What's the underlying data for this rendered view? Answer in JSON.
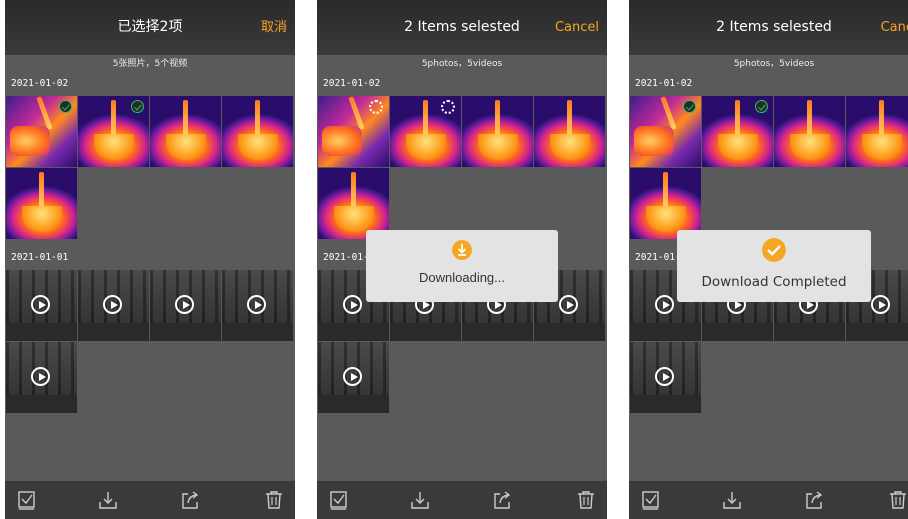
{
  "screens": [
    {
      "title": "已选择2项",
      "cancel": "取消",
      "subtitle": "5张照片，5个视频",
      "date_1": "2021-01-02",
      "date_2": "2021-01-01"
    },
    {
      "title": "2 Items selested",
      "cancel": "Cancel",
      "subtitle": "5photos，5videos",
      "date_1": "2021-01-02",
      "date_2": "2021-01-01",
      "toast": {
        "text": "Downloading...",
        "icon": "download-icon"
      }
    },
    {
      "title": "2 Items selested",
      "cancel": "Cance",
      "subtitle": "5photos，5videos",
      "date_1": "2021-01-02",
      "date_2": "2021-01-01",
      "toast": {
        "text": "Download Completed",
        "icon": "checkmark-icon"
      }
    }
  ],
  "colors": {
    "accent": "#f5a623",
    "selected": "#22c55e",
    "background": "#5a5a5a",
    "bar": "#3a3a3a"
  },
  "toolbar_icons": [
    "select-all-icon",
    "download-icon",
    "share-icon",
    "trash-icon"
  ]
}
